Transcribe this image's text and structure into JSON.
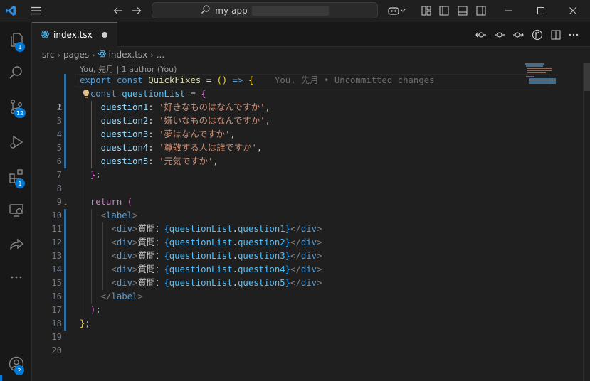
{
  "titlebar": {
    "search_text": "my-app",
    "icons": [
      "vscode-logo-icon",
      "menu-icon",
      "arrow-left-icon",
      "arrow-right-icon",
      "search-icon",
      "copilot-icon",
      "layout-icon",
      "sidebar-left-icon",
      "panel-icon",
      "sidebar-right-icon",
      "minimize-icon",
      "maximize-icon",
      "close-icon"
    ]
  },
  "activitybar": {
    "items": [
      {
        "name": "explorer",
        "badge": "1"
      },
      {
        "name": "search",
        "badge": ""
      },
      {
        "name": "source-control",
        "badge": "12"
      },
      {
        "name": "run-debug",
        "badge": ""
      },
      {
        "name": "extensions",
        "badge": "1"
      },
      {
        "name": "remote-explorer",
        "badge": ""
      },
      {
        "name": "live-share",
        "badge": ""
      },
      {
        "name": "more",
        "badge": ""
      }
    ],
    "accounts_badge": "2"
  },
  "tab": {
    "filename": "index.tsx",
    "dirty": true
  },
  "breadcrumb": {
    "items": [
      "src",
      "pages",
      "index.tsx",
      "..."
    ]
  },
  "editor": {
    "codelens": "You, 先月 | 1 author (You)",
    "blame": "You, 先月 • Uncommitted changes",
    "line_numbers": [
      "1",
      "2",
      "3",
      "4",
      "5",
      "6",
      "7",
      "8",
      "9",
      "10",
      "11",
      "12",
      "13",
      "14",
      "15",
      "16",
      "17",
      "18",
      "19",
      "20"
    ],
    "code": {
      "l1": {
        "kw": "export",
        "kw2": "const",
        "fn": "QuickFixes",
        "op": " = ",
        "paren": "()",
        "arrow": " => ",
        "brace": "{"
      },
      "l2": {
        "kw": "const",
        "var": "questionList",
        "op": " = ",
        "brace": "{"
      },
      "l3": {
        "prop": "question1",
        "str": "'好きなものはなんですか'"
      },
      "l4": {
        "prop": "question2",
        "str": "'嫌いなものはなんですか'"
      },
      "l5": {
        "prop": "question3",
        "str": "'夢はなんですか'"
      },
      "l6": {
        "prop": "question4",
        "str": "'尊敬する人は誰ですか'"
      },
      "l7": {
        "prop": "question5",
        "str": "'元気ですか'"
      },
      "l8": {
        "brace": "}",
        "semi": ";"
      },
      "l10": {
        "kw": "return",
        "paren": "("
      },
      "l11": {
        "tag": "label"
      },
      "l12": {
        "tag": "div",
        "label": "質問：",
        "var": "questionList",
        "prop": "question1"
      },
      "l13": {
        "tag": "div",
        "label": "質問：",
        "var": "questionList",
        "prop": "question2"
      },
      "l14": {
        "tag": "div",
        "label": "質問：",
        "var": "questionList",
        "prop": "question3"
      },
      "l15": {
        "tag": "div",
        "label": "質問：",
        "var": "questionList",
        "prop": "question4"
      },
      "l16": {
        "tag": "div",
        "label": "質問：",
        "var": "questionList",
        "prop": "question5"
      },
      "l17": {
        "tag": "label"
      },
      "l18": {
        "paren": ")",
        "semi": ";"
      },
      "l19": {
        "brace": "}",
        "semi": ";"
      }
    }
  },
  "colors": {
    "accent": "#0078d4",
    "background": "#1f1f1f",
    "keyword": "#569cd6",
    "string": "#ce9178"
  }
}
